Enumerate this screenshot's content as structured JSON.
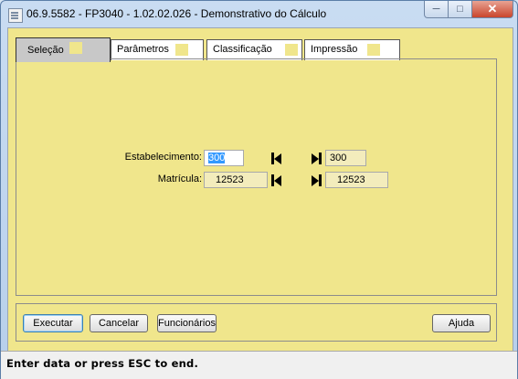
{
  "window": {
    "title": "06.9.5582 - FP3040 - 1.02.02.026 - Demonstrativo do Cálculo"
  },
  "tabs": [
    {
      "label": "Seleção",
      "active": true
    },
    {
      "label": "Parâmetros",
      "active": false
    },
    {
      "label": "Classificação",
      "active": false
    },
    {
      "label": "Impressão",
      "active": false
    }
  ],
  "form": {
    "estabelecimento": {
      "label": "Estabelecimento:",
      "from": "300",
      "to": "300"
    },
    "matricula": {
      "label": "Matrícula:",
      "from": "12523",
      "to": "12523"
    }
  },
  "buttons": {
    "executar": "Executar",
    "cancelar": "Cancelar",
    "funcionarios": "Funcionários",
    "ajuda": "Ajuda"
  },
  "status": "Enter data or press ESC to end.",
  "colors": {
    "form_background": "#f0e68c",
    "selection": "#3399ff"
  }
}
